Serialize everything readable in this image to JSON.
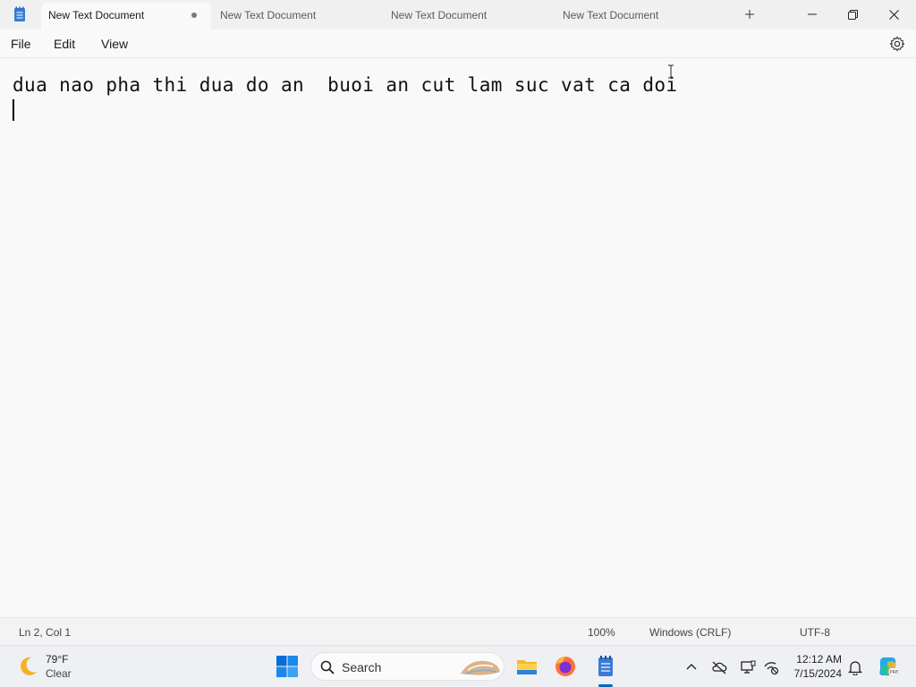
{
  "tabs": [
    {
      "label": "New Text Document",
      "active": true,
      "modified": true
    },
    {
      "label": "New Text Document",
      "active": false
    },
    {
      "label": "New Text Document",
      "active": false
    },
    {
      "label": "New Text Document",
      "active": false
    }
  ],
  "menu": {
    "file": "File",
    "edit": "Edit",
    "view": "View"
  },
  "editor": {
    "lines": [
      "dua nao pha thi dua do an  buoi an cut lam suc vat ca doi",
      ""
    ]
  },
  "status": {
    "position": "Ln 2, Col 1",
    "zoom": "100%",
    "line_ending": "Windows (CRLF)",
    "encoding": "UTF-8"
  },
  "taskbar": {
    "weather": {
      "temp": "79°F",
      "condition": "Clear",
      "icon": "moon-icon"
    },
    "search_label": "Search",
    "clock": {
      "time": "12:12 AM",
      "date": "7/15/2024"
    }
  },
  "colors": {
    "accent": "#0067c0"
  }
}
